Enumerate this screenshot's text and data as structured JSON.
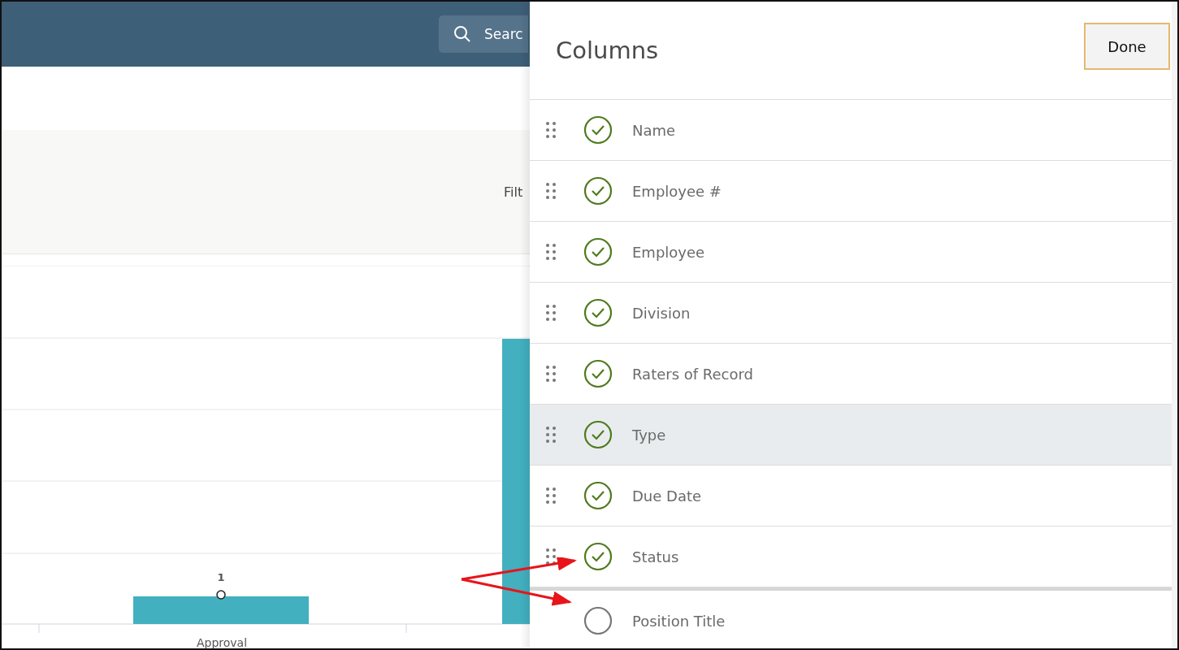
{
  "header": {
    "search": {
      "placeholder": "Searc"
    }
  },
  "filter_bar": {
    "label": "Filt"
  },
  "chart": {
    "data_label": "1",
    "category": "Approval"
  },
  "columns_panel": {
    "title": "Columns",
    "done_button": "Done",
    "items": [
      {
        "label": "Name",
        "checked": true,
        "hovered": false,
        "kind": "draggable"
      },
      {
        "label": "Employee #",
        "checked": true,
        "hovered": false,
        "kind": "draggable"
      },
      {
        "label": "Employee",
        "checked": true,
        "hovered": false,
        "kind": "draggable"
      },
      {
        "label": "Division",
        "checked": true,
        "hovered": false,
        "kind": "draggable"
      },
      {
        "label": "Raters of Record",
        "checked": true,
        "hovered": false,
        "kind": "draggable"
      },
      {
        "label": "Type",
        "checked": true,
        "hovered": true,
        "kind": "draggable"
      },
      {
        "label": "Due Date",
        "checked": true,
        "hovered": false,
        "kind": "draggable"
      },
      {
        "label": "Status",
        "checked": true,
        "hovered": false,
        "kind": "draggable"
      },
      {
        "label": "Position Title",
        "checked": false,
        "hovered": false,
        "kind": "available"
      }
    ]
  }
}
